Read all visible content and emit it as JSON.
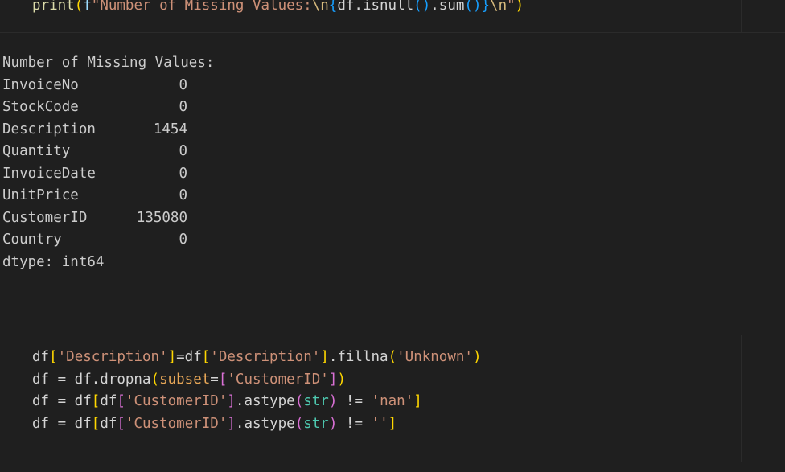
{
  "top_cell": {
    "line": {
      "fn": "print",
      "p_open": "(",
      "f_prefix": "f",
      "str_start": "\"Number of Missing Values:",
      "esc1": "\\n",
      "brace_open": "{",
      "expr1": "df.isnull",
      "call1": "()",
      "dot": ".sum",
      "call2": "()",
      "brace_close": "}",
      "esc2": "\\n",
      "str_end": "\"",
      "p_close": ")"
    }
  },
  "output": {
    "header": "Number of Missing Values:",
    "rows": [
      {
        "name": "InvoiceNo",
        "value": "0"
      },
      {
        "name": "StockCode",
        "value": "0"
      },
      {
        "name": "Description",
        "value": "1454"
      },
      {
        "name": "Quantity",
        "value": "0"
      },
      {
        "name": "InvoiceDate",
        "value": "0"
      },
      {
        "name": "UnitPrice",
        "value": "0"
      },
      {
        "name": "CustomerID",
        "value": "135080"
      },
      {
        "name": "Country",
        "value": "0"
      }
    ],
    "dtype": "dtype: int64"
  },
  "bottom_cell": {
    "l1": {
      "a": "df",
      "b": "[",
      "c": "'Description'",
      "d": "]",
      "e": "=df",
      "f": "[",
      "g": "'Description'",
      "h": "]",
      "i": ".fillna",
      "j": "(",
      "k": "'Unknown'",
      "l": ")"
    },
    "l2": {
      "a": "df = df.dropna",
      "b": "(",
      "c": "subset",
      "d": "=",
      "e": "[",
      "f": "'CustomerID'",
      "g": "]",
      "h": ")"
    },
    "l3": {
      "a": "df = df",
      "b": "[",
      "c": "df",
      "d": "[",
      "e": "'CustomerID'",
      "f": "]",
      "g": ".astype",
      "h": "(",
      "i": "str",
      "j": ")",
      "k": " != ",
      "l": "'nan'",
      "m": "]"
    },
    "l4": {
      "a": "df = df",
      "b": "[",
      "c": "df",
      "d": "[",
      "e": "'CustomerID'",
      "f": "]",
      "g": ".astype",
      "h": "(",
      "i": "str",
      "j": ")",
      "k": " != ",
      "l": "''",
      "m": "]"
    }
  }
}
